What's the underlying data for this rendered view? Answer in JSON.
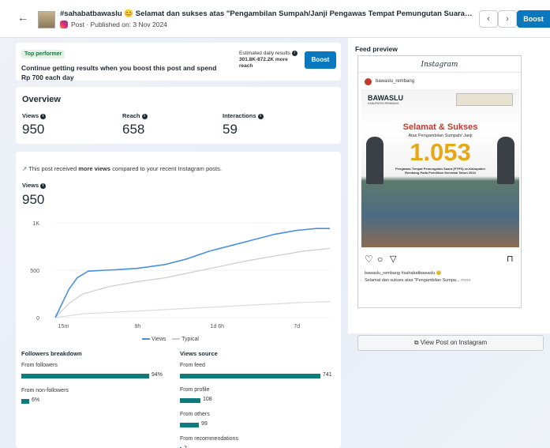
{
  "header": {
    "title": "#sahabatbawaslu 😊 Selamat dan sukses atas \"Pengambilan Sumpah/Janji Pengawas Tempat Pemungutan Suara (PTPS) s...",
    "subtitle": "Post · Published on: 3 Nov 2024",
    "boost_label": "Boost"
  },
  "top_performer": {
    "badge": "Top performer",
    "message": "Continue getting results when you boost this post and spend Rp 700 each day",
    "est_label": "Estimated daily results",
    "est_value": "301.8K-872.2K more reach",
    "boost_label": "Boost"
  },
  "overview": {
    "title": "Overview",
    "metrics": [
      {
        "label": "Views",
        "value": "950"
      },
      {
        "label": "Reach",
        "value": "658"
      },
      {
        "label": "Interactions",
        "value": "59"
      }
    ]
  },
  "views_section": {
    "note_pre": "This post received ",
    "note_bold": "more views",
    "note_post": " compared to your recent Instagram posts.",
    "label": "Views",
    "value": "950",
    "legend_views": "Views",
    "legend_typical": "Typical"
  },
  "chart_data": {
    "type": "line",
    "x_ticks": [
      "15m",
      "9h",
      "1d 6h",
      "7d"
    ],
    "y_ticks": [
      "0",
      "500",
      "1K"
    ],
    "ylim": [
      0,
      1000
    ],
    "series": [
      {
        "name": "Views",
        "color": "#4a90d9",
        "x": [
          0,
          0.02,
          0.05,
          0.08,
          0.12,
          0.18,
          0.22,
          0.3,
          0.4,
          0.48,
          0.56,
          0.64,
          0.72,
          0.8,
          0.88,
          0.95,
          1.0
        ],
        "values": [
          0,
          120,
          300,
          420,
          490,
          500,
          505,
          520,
          560,
          620,
          700,
          760,
          820,
          880,
          920,
          940,
          940
        ]
      },
      {
        "name": "Typical",
        "color": "#c9ccd1",
        "x": [
          0,
          0.05,
          0.1,
          0.2,
          0.3,
          0.4,
          0.5,
          0.6,
          0.7,
          0.8,
          0.9,
          1.0
        ],
        "values": [
          0,
          150,
          250,
          330,
          380,
          420,
          480,
          540,
          600,
          650,
          700,
          730
        ]
      },
      {
        "name": "Baseline",
        "color": "#d8dbe0",
        "x": [
          0,
          0.1,
          0.3,
          0.5,
          0.7,
          0.9,
          1.0
        ],
        "values": [
          0,
          40,
          70,
          100,
          130,
          160,
          170
        ]
      }
    ]
  },
  "followers": {
    "title": "Followers breakdown",
    "rows": [
      {
        "label": "From followers",
        "value": "94%",
        "frac": 0.94
      },
      {
        "label": "From non-followers",
        "value": "6%",
        "frac": 0.06
      }
    ]
  },
  "views_source": {
    "title": "Views source",
    "rows": [
      {
        "label": "From feed",
        "value": "741",
        "frac": 1.0
      },
      {
        "label": "From profile",
        "value": "108",
        "frac": 0.146
      },
      {
        "label": "From others",
        "value": "99",
        "frac": 0.134
      },
      {
        "label": "From recommendations",
        "value": "2",
        "frac": 0.003
      }
    ]
  },
  "feed_preview": {
    "title": "Feed preview",
    "ig_brand": "Instagram",
    "username": "bawaslu_rembang",
    "org": "BAWASLU",
    "org_sub": "KABUPATEN REMBANG",
    "poster_title": "Selamat & Sukses",
    "poster_sub": "Atas Pengambilan Sumpah/ Janji",
    "poster_number": "1.053",
    "poster_body": "Pengawas Tempat Pemungutan Suara (PTPS) se-Kabupaten Rembang Pada Pemilihan Serentak Tahun 2024",
    "caption_user": "bawaslu_rembang #sahabatbawaslu 😊",
    "caption_text": "Selamat dan sukses atas \"Pengambilan Sumpa...",
    "more": "more",
    "view_post": "View Post on Instagram"
  }
}
